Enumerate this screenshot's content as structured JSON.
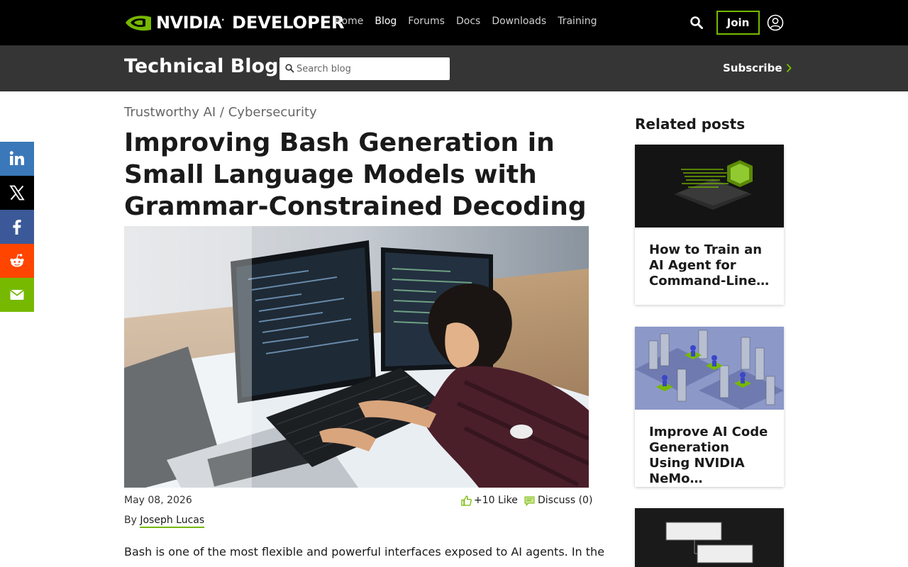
{
  "topnav": {
    "brand": "NVIDIA",
    "brand_sub": "DEVELOPER",
    "links": [
      "Home",
      "Blog",
      "Forums",
      "Docs",
      "Downloads",
      "Training"
    ],
    "active_link": "Blog",
    "join_label": "Join",
    "accent_color": "#76b900"
  },
  "subheader": {
    "title": "Technical Blog",
    "search_placeholder": "Search blog",
    "subscribe_label": "Subscribe"
  },
  "share": {
    "items": [
      {
        "name": "linkedin",
        "color": "#3b78b9"
      },
      {
        "name": "x",
        "color": "#000000"
      },
      {
        "name": "facebook",
        "color": "#3b5998"
      },
      {
        "name": "reddit",
        "color": "#ff4500"
      },
      {
        "name": "email",
        "color": "#76b900"
      }
    ]
  },
  "article": {
    "breadcrumb": [
      "Trustworthy AI",
      "Cybersecurity"
    ],
    "breadcrumb_sep": " / ",
    "title": "Improving Bash Generation in Small Language Models with Grammar-Constrained Decoding",
    "date": "May 08, 2026",
    "likes": "+10 Like",
    "discuss": "Discuss (0)",
    "by": "By",
    "author": "Joseph Lucas",
    "intro": "Bash is one of the most flexible and powerful interfaces exposed to AI agents. In the"
  },
  "related": {
    "heading": "Related posts",
    "posts": [
      {
        "title": "How to Train an AI Agent for Command-Line…"
      },
      {
        "title": "Improve AI Code Generation Using NVIDIA NeMo…"
      },
      {
        "title": ""
      }
    ]
  }
}
